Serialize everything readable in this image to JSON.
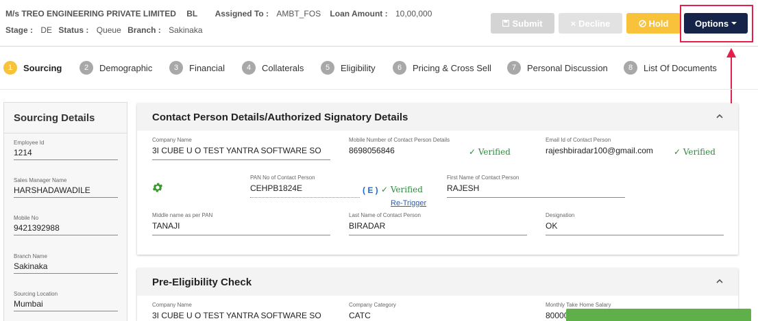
{
  "header": {
    "company": "M/s TREO ENGINEERING PRIVATE LIMITED",
    "bl": "BL",
    "assigned_to_label": "Assigned To :",
    "assigned_to_value": "AMBT_FOS",
    "loan_amount_label": "Loan Amount :",
    "loan_amount_value": "10,00,000",
    "stage_label": "Stage :",
    "stage_value": "DE",
    "status_label": "Status :",
    "status_value": "Queue",
    "branch_label": "Branch :",
    "branch_value": "Sakinaka"
  },
  "actions": {
    "submit": "Submit",
    "decline": "Decline",
    "hold": "Hold",
    "options": "Options"
  },
  "steps": [
    {
      "num": "1",
      "label": "Sourcing"
    },
    {
      "num": "2",
      "label": "Demographic"
    },
    {
      "num": "3",
      "label": "Financial"
    },
    {
      "num": "4",
      "label": "Collaterals"
    },
    {
      "num": "5",
      "label": "Eligibility"
    },
    {
      "num": "6",
      "label": "Pricing & Cross Sell"
    },
    {
      "num": "7",
      "label": "Personal Discussion"
    },
    {
      "num": "8",
      "label": "List Of Documents"
    }
  ],
  "sidebar": {
    "title": "Sourcing Details",
    "fields": [
      {
        "label": "Employee Id",
        "value": "1214"
      },
      {
        "label": "Sales Manager Name",
        "value": "HARSHADAWADILE"
      },
      {
        "label": "Mobile No",
        "value": "9421392988"
      },
      {
        "label": "Branch Name",
        "value": "Sakinaka"
      },
      {
        "label": "Sourcing Location",
        "value": "Mumbai"
      }
    ]
  },
  "contact": {
    "title": "Contact Person Details/Authorized Signatory Details",
    "company_name_label": "Company Name",
    "company_name_value": "3I CUBE U O TEST YANTRA SOFTWARE SO",
    "mobile_label": "Mobile Number of Contact Person Details",
    "mobile_value": "8698056846",
    "email_label": "Email Id of Contact Person",
    "email_value": "rajeshbiradar100@gmail.com",
    "verified_text": "✓ Verified",
    "pan_label": "PAN No of Contact Person",
    "pan_value": "CEHPB1824E",
    "e_tag": "( E )",
    "retrigger": "Re-Trigger",
    "first_name_label": "First Name of Contact Person",
    "first_name_value": "RAJESH",
    "middle_name_label": "Middle name as per PAN",
    "middle_name_value": "TANAJI",
    "last_name_label": "Last Name of Contact Person",
    "last_name_value": "BIRADAR",
    "designation_label": "Designation",
    "designation_value": "OK"
  },
  "pre_eligibility": {
    "title": "Pre-Eligibility Check",
    "company_name_label": "Company Name",
    "company_name_value": "3I CUBE U O TEST YANTRA SOFTWARE SO",
    "category_label": "Company Category",
    "category_value": "CATC",
    "salary_label": "Monthly Take Home Salary",
    "salary_value": "80000"
  },
  "colors": {
    "primary_dark": "#16244a",
    "hold": "#f8c33a",
    "verified": "#2e8b3d",
    "highlight": "#e3204c",
    "gear": "#3a9a2e"
  }
}
